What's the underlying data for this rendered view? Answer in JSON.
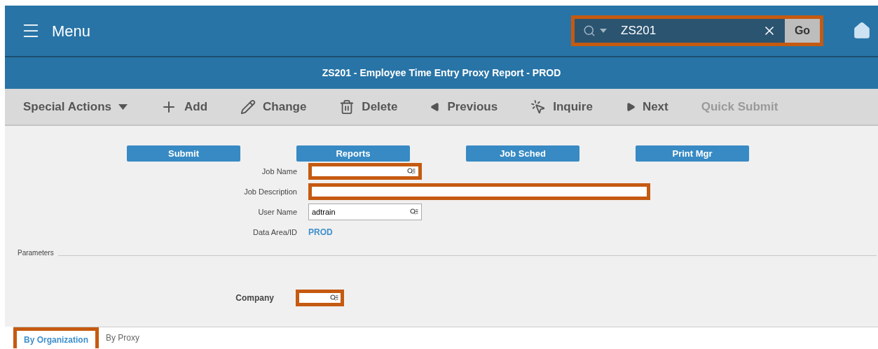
{
  "header": {
    "menu_label": "Menu",
    "search": {
      "value": "ZS201",
      "highlighted": true,
      "go_label": "Go"
    }
  },
  "title": "ZS201 - Employee Time Entry Proxy Report - PROD",
  "toolbar": [
    {
      "kind": "dropdown",
      "label": "Special Actions",
      "disabled": false
    },
    {
      "kind": "add",
      "label": "Add",
      "disabled": false
    },
    {
      "kind": "change",
      "label": "Change",
      "disabled": false
    },
    {
      "kind": "delete",
      "label": "Delete",
      "disabled": false
    },
    {
      "kind": "previous",
      "label": "Previous",
      "disabled": false
    },
    {
      "kind": "inquire",
      "label": "Inquire",
      "disabled": false
    },
    {
      "kind": "next",
      "label": "Next",
      "disabled": false
    },
    {
      "kind": "text",
      "label": "Quick Submit",
      "disabled": true
    }
  ],
  "action_buttons": [
    "Submit",
    "Reports",
    "Job Sched",
    "Print Mgr"
  ],
  "fields": [
    {
      "kind": "lookup",
      "label": "Job Name",
      "highlighted": true
    },
    {
      "kind": "wide",
      "label": "Job Description",
      "highlighted": true
    },
    {
      "kind": "lookup",
      "label": "User Name",
      "value": "adtrain",
      "highlighted": false
    },
    {
      "kind": "link",
      "label": "Data Area/ID",
      "value": "PROD"
    }
  ],
  "parameters": {
    "legend": "Parameters",
    "company": {
      "label": "Company",
      "highlighted": true
    }
  },
  "tabs": [
    {
      "label": "By Organization",
      "selected": true,
      "highlighted": true
    },
    {
      "label": "By Proxy",
      "selected": false,
      "highlighted": false
    }
  ]
}
